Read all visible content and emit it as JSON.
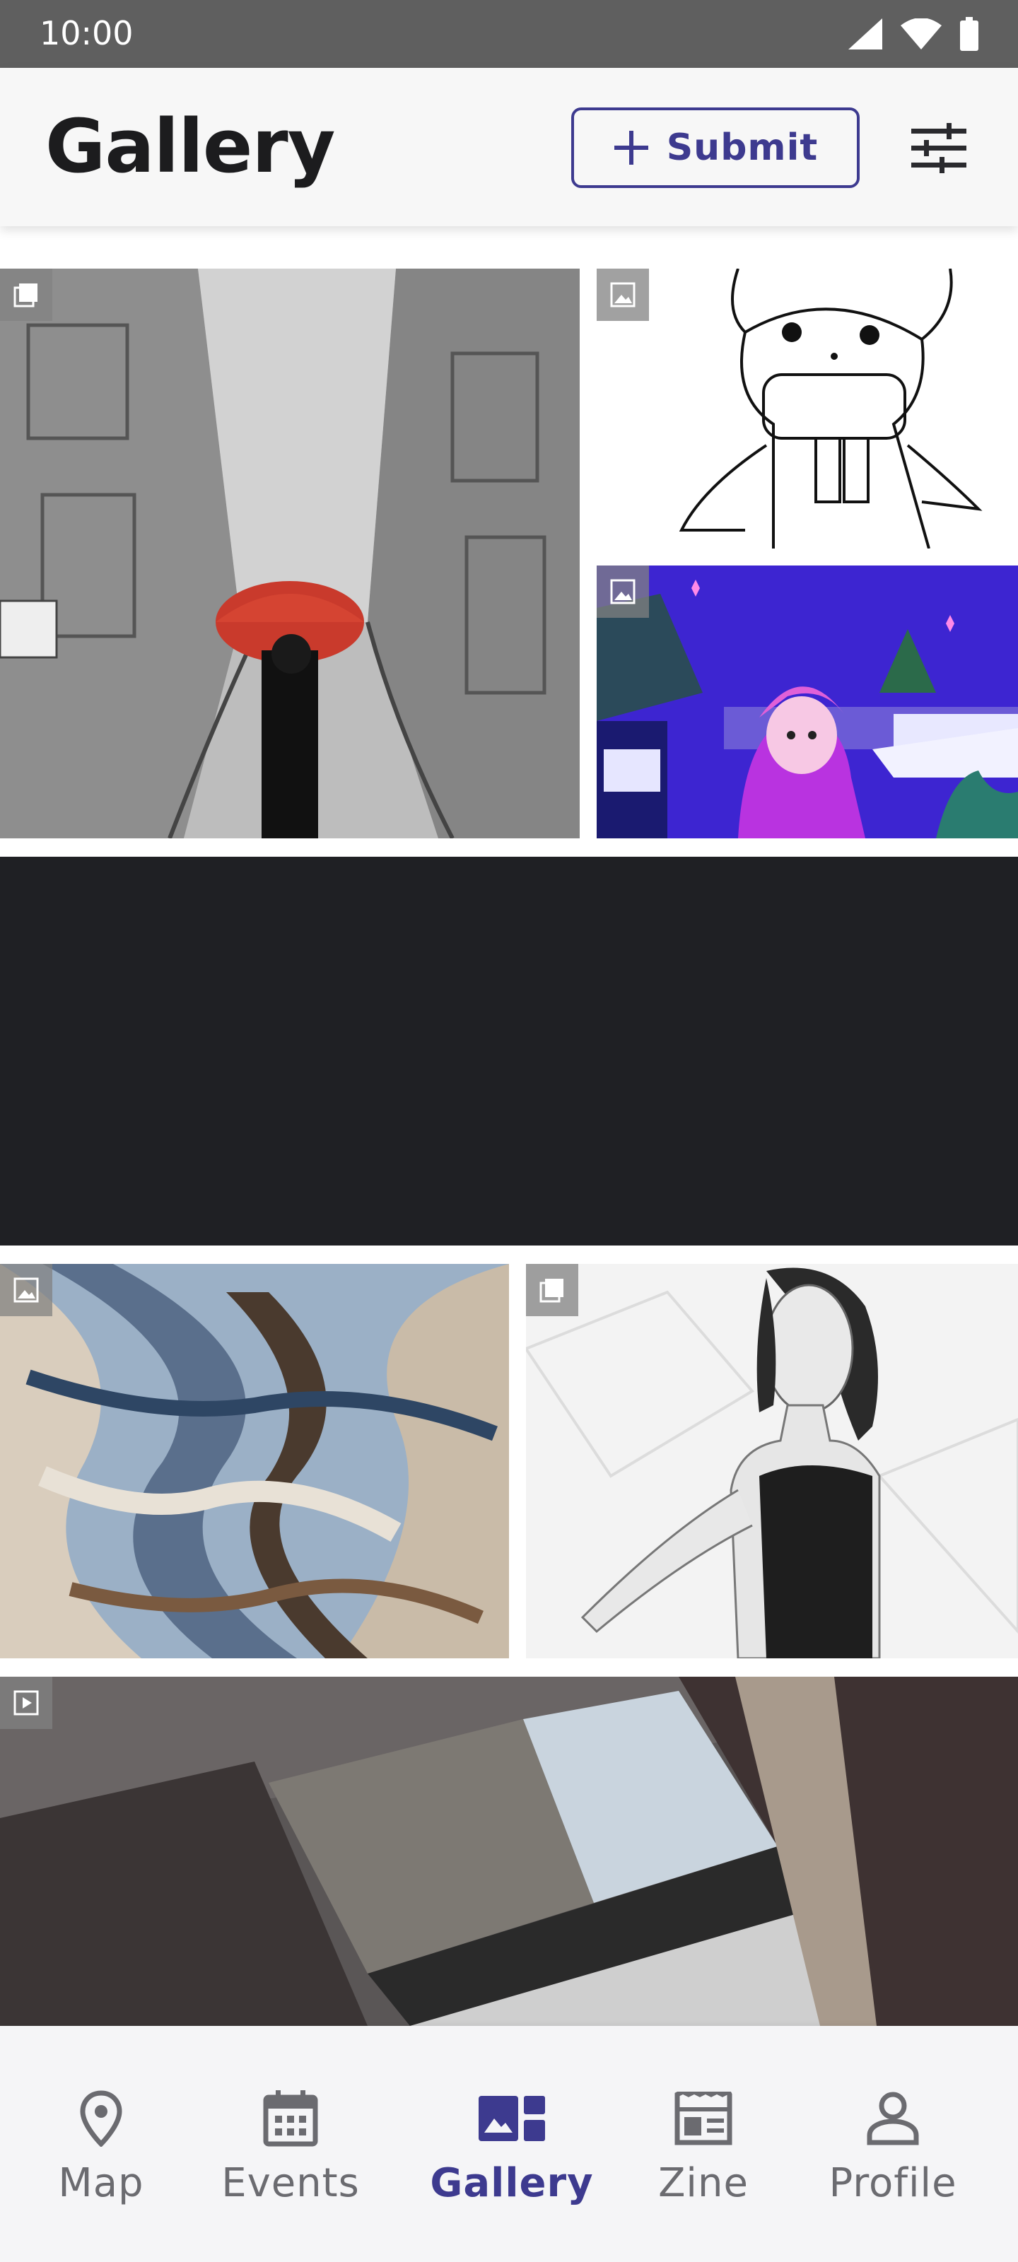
{
  "status_bar": {
    "time": "10:00"
  },
  "app_bar": {
    "title": "Gallery",
    "submit_label": "Submit"
  },
  "gallery": {
    "items": [
      {
        "type": "gallery",
        "subject": "sketch of woman with red umbrella in alley"
      },
      {
        "type": "image",
        "subject": "line drawing of bunny"
      },
      {
        "type": "image",
        "subject": "neon purple illustration of hooded girl"
      },
      {
        "type": "placeholder",
        "subject": ""
      },
      {
        "type": "image",
        "subject": "abstract swirl"
      },
      {
        "type": "gallery",
        "subject": "sketch of woman portrait"
      },
      {
        "type": "video",
        "subject": "ceiling window and curtains"
      }
    ]
  },
  "nav": {
    "items": [
      {
        "label": "Map",
        "icon": "map-pin-icon",
        "active": false
      },
      {
        "label": "Events",
        "icon": "calendar-icon",
        "active": false
      },
      {
        "label": "Gallery",
        "icon": "gallery-icon",
        "active": true
      },
      {
        "label": "Zine",
        "icon": "newspaper-icon",
        "active": false
      },
      {
        "label": "Profile",
        "icon": "person-icon",
        "active": false
      }
    ]
  },
  "colors": {
    "accent": "#3d3a8f",
    "placeholder_tile": "#1f2024"
  }
}
